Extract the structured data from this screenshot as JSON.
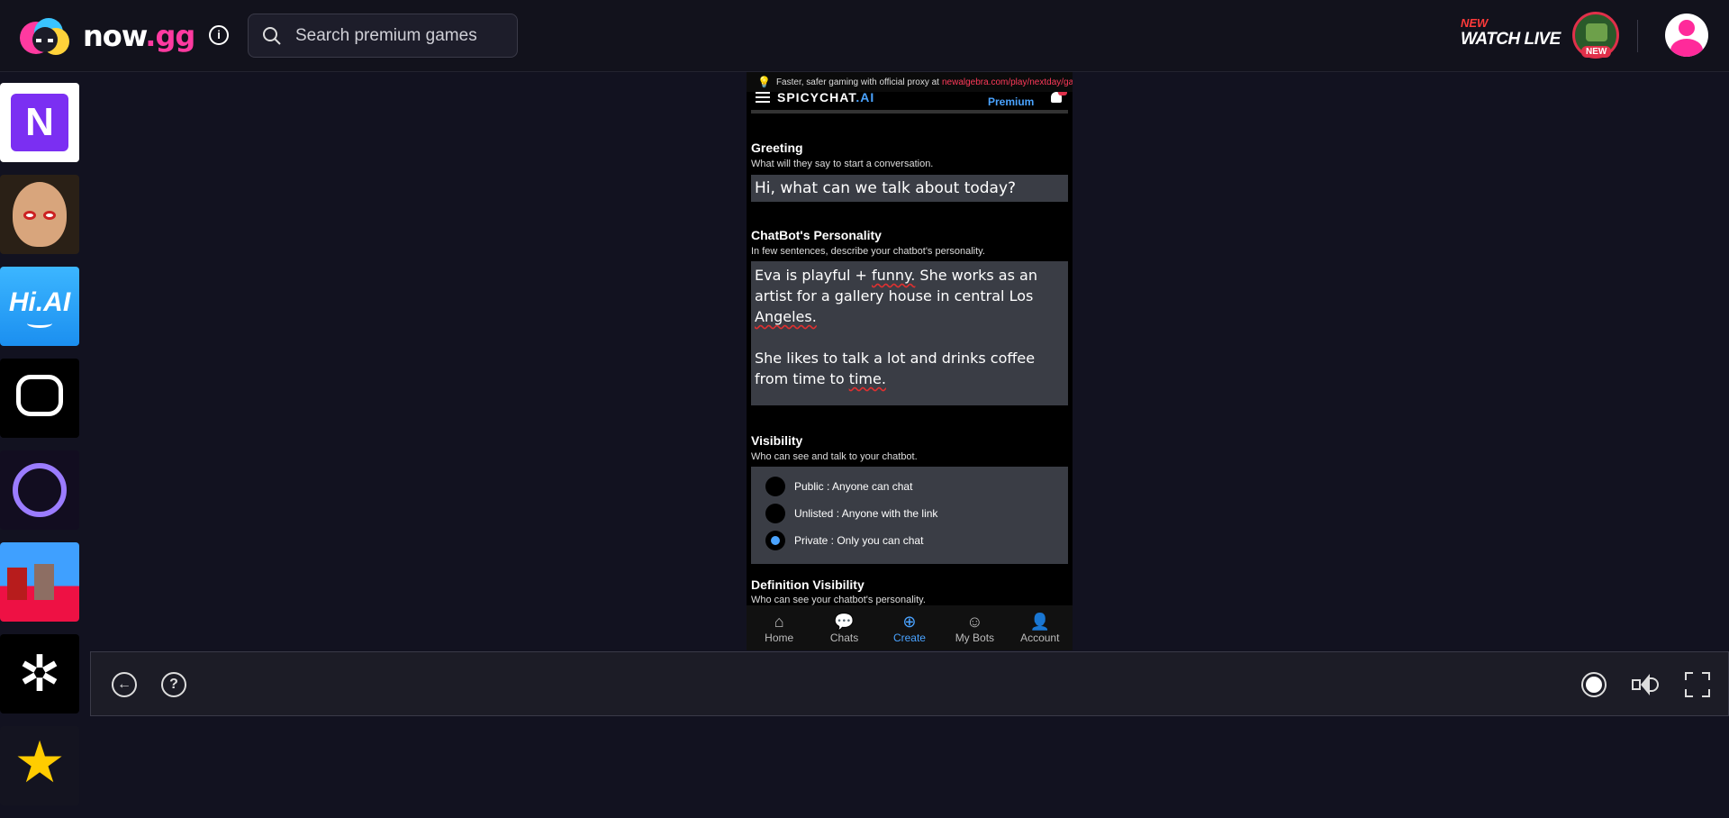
{
  "header": {
    "logo_text_main": "now",
    "logo_text_dot": ".gg",
    "search": {
      "placeholder": "Search premium games"
    },
    "watch_live": {
      "new_label": "NEW",
      "label": "WATCH LIVE",
      "badge": "NEW"
    }
  },
  "sidebar": {
    "tiles": [
      {
        "name": "n-app",
        "glyph": "N"
      },
      {
        "name": "baby-game"
      },
      {
        "name": "hi-ai",
        "glyph": "Hi.AI"
      },
      {
        "name": "chat-app"
      },
      {
        "name": "talkie-app"
      },
      {
        "name": "minecraft-style-game"
      },
      {
        "name": "chatgpt-app",
        "glyph": "✲"
      },
      {
        "name": "star-app",
        "glyph": "★"
      }
    ]
  },
  "game": {
    "proxy_text": "Faster, safer gaming with official proxy at",
    "proxy_link": "newalgebra.com/play/nextday/gam",
    "app_logo": "SPICYCHAT",
    "app_logo_ai": ".AI",
    "premium": "Premium",
    "greeting": {
      "title": "Greeting",
      "subtitle": "What will they say to start a conversation.",
      "value": "Hi, what can we talk about today?"
    },
    "personality": {
      "title": "ChatBot's Personality",
      "subtitle": "In few sentences, describe your chatbot's personality.",
      "p1_a": "Eva is playful + ",
      "p1_b": "funny.",
      "p1_c": " She works as an artist for a gallery house in central Los ",
      "p1_d": "Angeles.",
      "p2_a": "She likes to talk a lot and drinks coffee from time to ",
      "p2_b": "time."
    },
    "visibility": {
      "title": "Visibility",
      "subtitle": "Who can see and talk to your chatbot.",
      "options": [
        {
          "label": "Public : Anyone can chat",
          "selected": false
        },
        {
          "label": "Unlisted : Anyone with the link",
          "selected": false
        },
        {
          "label": "Private : Only you can chat",
          "selected": true
        }
      ]
    },
    "definition_visibility": {
      "title": "Definition Visibility",
      "subtitle": "Who can see your chatbot's personality."
    },
    "nav": [
      {
        "label": "Home",
        "glyph": "⌂"
      },
      {
        "label": "Chats",
        "glyph": "💬"
      },
      {
        "label": "Create",
        "glyph": "⊕",
        "active": true
      },
      {
        "label": "My Bots",
        "glyph": "☺"
      },
      {
        "label": "Account",
        "glyph": "👤"
      }
    ]
  },
  "controls": {
    "back_glyph": "←",
    "help_glyph": "?"
  }
}
